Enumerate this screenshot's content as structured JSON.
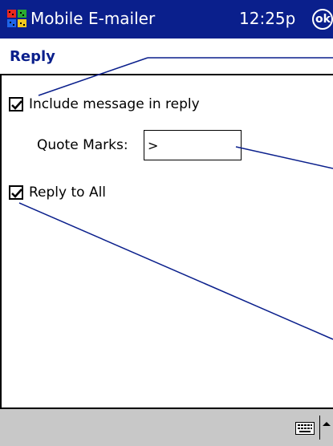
{
  "title_bar": {
    "app_title": "Mobile E-mailer",
    "time": "12:25p",
    "ok_label": "ok"
  },
  "page": {
    "title": "Reply"
  },
  "options": {
    "include_message": {
      "label": "Include message in reply",
      "checked": true
    },
    "quote_marks": {
      "label": "Quote Marks:",
      "value": ">"
    },
    "reply_to_all": {
      "label": "Reply to All",
      "checked": true
    }
  },
  "menu_bar": {
    "input_icon": "keyboard-icon",
    "input_arrow": "up-arrow-icon"
  },
  "colors": {
    "title_bar": "#0a1f8c",
    "menu_bar": "#c8c8c8",
    "callout_line": "#0a1f8c"
  }
}
